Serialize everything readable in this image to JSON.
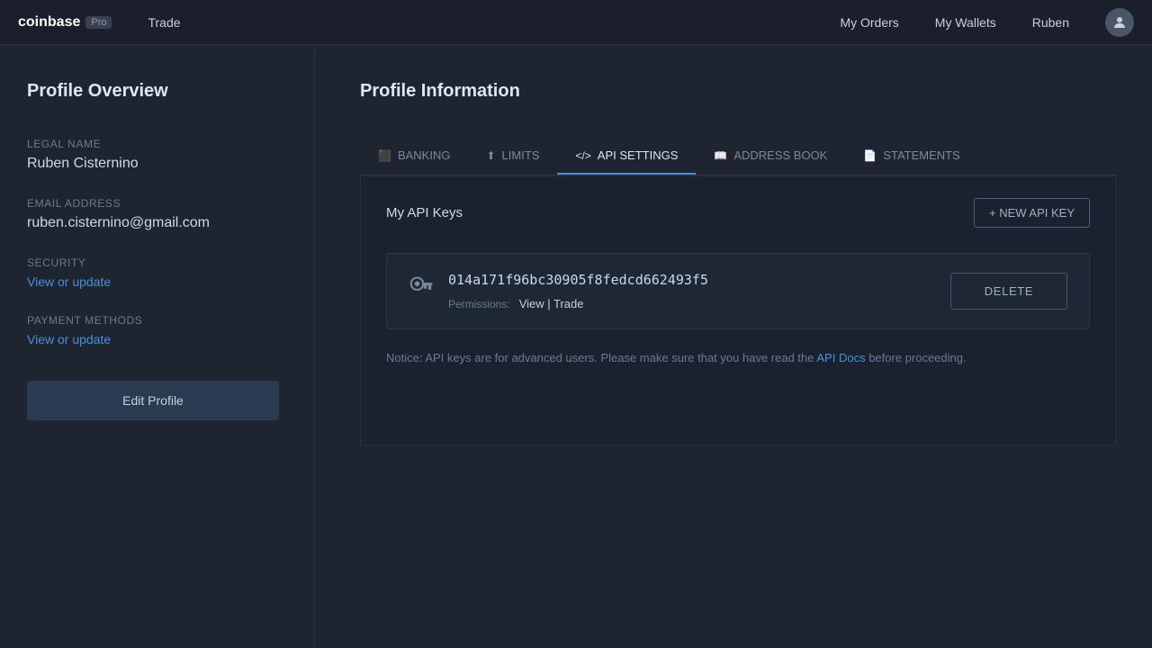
{
  "brand": {
    "name": "coinbase",
    "pro": "Pro"
  },
  "nav": {
    "trade_label": "Trade",
    "my_orders_label": "My Orders",
    "my_wallets_label": "My Wallets",
    "username": "Ruben"
  },
  "sidebar": {
    "title": "Profile Overview",
    "legal_name_label": "Legal name",
    "legal_name_value": "Ruben Cisternino",
    "email_label": "Email address",
    "email_value": "ruben.cisternino@gmail.com",
    "security_label": "Security",
    "security_link": "View or update",
    "payment_label": "Payment Methods",
    "payment_link": "View or update",
    "edit_profile_btn": "Edit Profile"
  },
  "main": {
    "page_title": "Profile Information",
    "tabs": [
      {
        "id": "banking",
        "label": "BANKING",
        "icon": "🏦"
      },
      {
        "id": "limits",
        "label": "LIMITS",
        "icon": "⬆"
      },
      {
        "id": "api_settings",
        "label": "API SETTINGS",
        "icon": "</>"
      },
      {
        "id": "address_book",
        "label": "ADDRESS BOOK",
        "icon": "📖"
      },
      {
        "id": "statements",
        "label": "STATEMENTS",
        "icon": "📄"
      }
    ],
    "active_tab": "api_settings",
    "api_keys": {
      "section_title": "My API Keys",
      "new_api_btn": "+ NEW API KEY",
      "keys": [
        {
          "key": "014a171f96bc30905f8fedcd662493f5",
          "permissions_label": "Permissions:",
          "permissions_value": "View | Trade"
        }
      ],
      "delete_btn": "DELETE",
      "notice_text": "Notice: API keys are for advanced users. Please make sure that you have read the ",
      "notice_link_text": "API Docs",
      "notice_suffix": " before proceeding."
    }
  }
}
